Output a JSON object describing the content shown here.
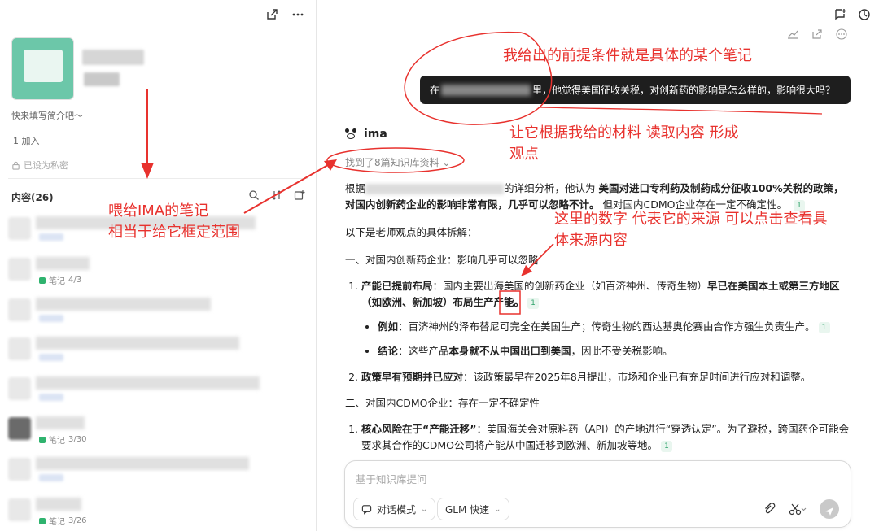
{
  "left_panel": {
    "intro": "快来填写简介吧～",
    "members": "1 加入",
    "privacy": "已设为私密",
    "content_header": "内容(26)",
    "notes": [
      {
        "type_label": "",
        "date": ""
      },
      {
        "type_label": "笔记",
        "date": "4/3"
      },
      {
        "type_label": "",
        "date": ""
      },
      {
        "type_label": "",
        "date": ""
      },
      {
        "type_label": "",
        "date": ""
      },
      {
        "type_label": "笔记",
        "date": "3/30"
      },
      {
        "type_label": "",
        "date": ""
      },
      {
        "type_label": "笔记",
        "date": "3/26"
      }
    ]
  },
  "chat": {
    "user_message_prefix": "在",
    "user_message_suffix": "里，他觉得美国征收关税，对创新药的影响是怎么样的，影响很大吗？",
    "bot_name": "ima",
    "sources_found": "找到了8篇知识库资料",
    "answer": {
      "intro_start": "根据",
      "intro_mid": "的详细分析，他认为",
      "intro_bold": "美国对进口专利药及制药成分征收100%关税的政策，对国内创新药企业的影响非常有限，几乎可以忽略不计。",
      "intro_end": "但对国内CDMO企业存在一定不确定性。",
      "intro_cite": "1",
      "lead": "以下是老师观点的具体拆解：",
      "section1": "一、对国内创新药企业：影响几乎可以忽略",
      "item1_bold": "产能已提前布局",
      "item1_text": "：国内主要出海美国的创新药企业（如百济神州、传奇生物）",
      "item1_bold2": "早已在美国本土或第三方地区（如欧洲、新加坡）布局生产产能。",
      "item1_cite": "1",
      "sub1_bold": "例如",
      "sub1_text": "：百济神州的泽布替尼可完全在美国生产；传奇生物的西达基奥伦赛由合作方强生负责生产。",
      "sub1_cite": "1",
      "sub2_bold": "结论",
      "sub2_text": "：这些产品",
      "sub2_bold2": "本身就不从中国出口到美国",
      "sub2_text2": "，因此不受关税影响。",
      "item2_bold": "政策早有预期并已应对",
      "item2_text": "：该政策最早在2025年8月提出，市场和企业已有充足时间进行应对和调整。",
      "section2": "二、对国内CDMO企业：存在一定不确定性",
      "item3_bold": "核心风险在于“产能迁移”",
      "item3_text": "：美国海关会对原料药（API）的产地进行“穿透认定”。为了避税，跨国药企可能会要求其合作的CDMO公司将产能从中国迁移到欧洲、新加坡等地。",
      "item3_cite": "1"
    }
  },
  "input": {
    "placeholder": "基于知识库提问",
    "mode_label": "对话模式",
    "model_label": "GLM 快速"
  },
  "annotations": {
    "a1": "我给出的前提条件就是具体的某个笔记",
    "a2_line1": "让它根据我给的材料 读取内容 形成",
    "a2_line2": "观点",
    "a3_line1": "这里的数字 代表它的来源 可以点击查看具",
    "a3_line2": "体来源内容",
    "a4_line1": "喂给IMA的笔记",
    "a4_line2": "相当于给它框定范围"
  },
  "colors": {
    "annotation_red": "#e8322e",
    "note_tag_green": "#2fb36e",
    "user_bubble": "#1e1e1e"
  }
}
